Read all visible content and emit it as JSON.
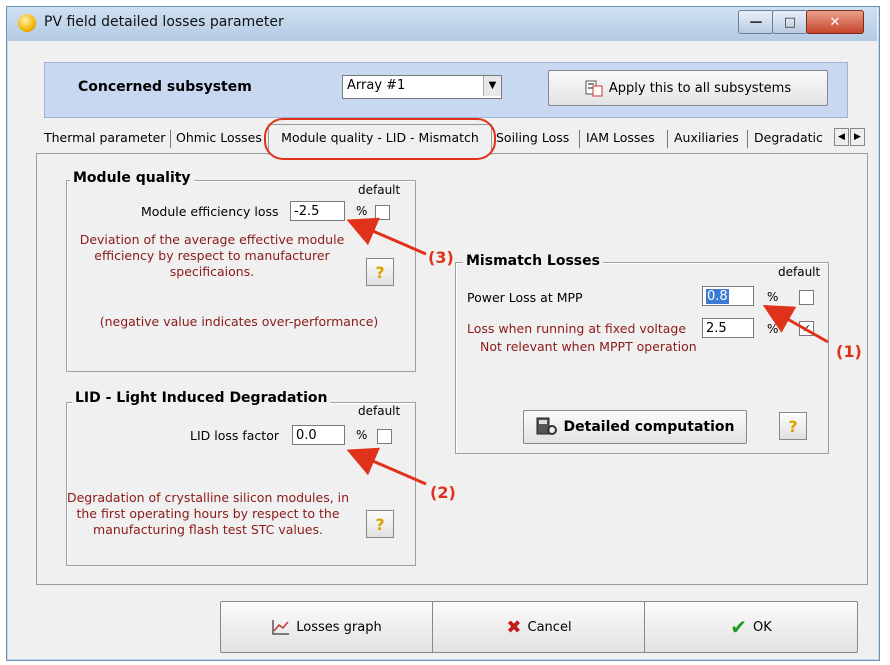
{
  "window": {
    "title": "PV field detailed losses parameter"
  },
  "subsystem": {
    "label": "Concerned subsystem",
    "selected": "Array #1",
    "apply_label": "Apply this to all subsystems"
  },
  "tabs": [
    {
      "label": "Thermal parameter"
    },
    {
      "label": "Ohmic Losses"
    },
    {
      "label": "Module quality - LID - Mismatch"
    },
    {
      "label": "Soiling Loss"
    },
    {
      "label": "IAM Losses"
    },
    {
      "label": "Auxiliaries"
    },
    {
      "label": "Degradatic"
    }
  ],
  "module_quality": {
    "title": "Module quality",
    "default_label": "default",
    "field_label": "Module efficiency loss",
    "value": "-2.5",
    "unit": "%",
    "desc_lines": [
      "Deviation of the average effective module",
      "efficiency by respect to manufacturer",
      "specificaions."
    ],
    "note": "(negative value indicates over-performance)"
  },
  "lid": {
    "title": "LID - Light Induced Degradation",
    "default_label": "default",
    "field_label": "LID loss factor",
    "value": "0.0",
    "unit": "%",
    "desc_lines": [
      "Degradation of crystalline silicon modules, in",
      "the first operating hours by respect to the",
      "manufacturing flash test STC values."
    ]
  },
  "mismatch": {
    "title": "Mismatch Losses",
    "default_label": "default",
    "power_label": "Power Loss at MPP",
    "power_value": "0.8",
    "fixed_label": "Loss when running at fixed voltage",
    "fixed_value": "2.5",
    "fixed_note": "Not relevant when MPPT operation",
    "unit": "%",
    "detailed_label": "Detailed computation"
  },
  "annotations": [
    "(1)",
    "(2)",
    "(3)"
  ],
  "help_glyph": "?",
  "buttons": {
    "graph": "Losses graph",
    "cancel": "Cancel",
    "ok": "OK"
  },
  "colors": {
    "annotation": "#e0321a",
    "desc_text": "#8b1a1a",
    "highlight": "#3a7bd5",
    "subsystem_bg": "#c8d8f0"
  }
}
